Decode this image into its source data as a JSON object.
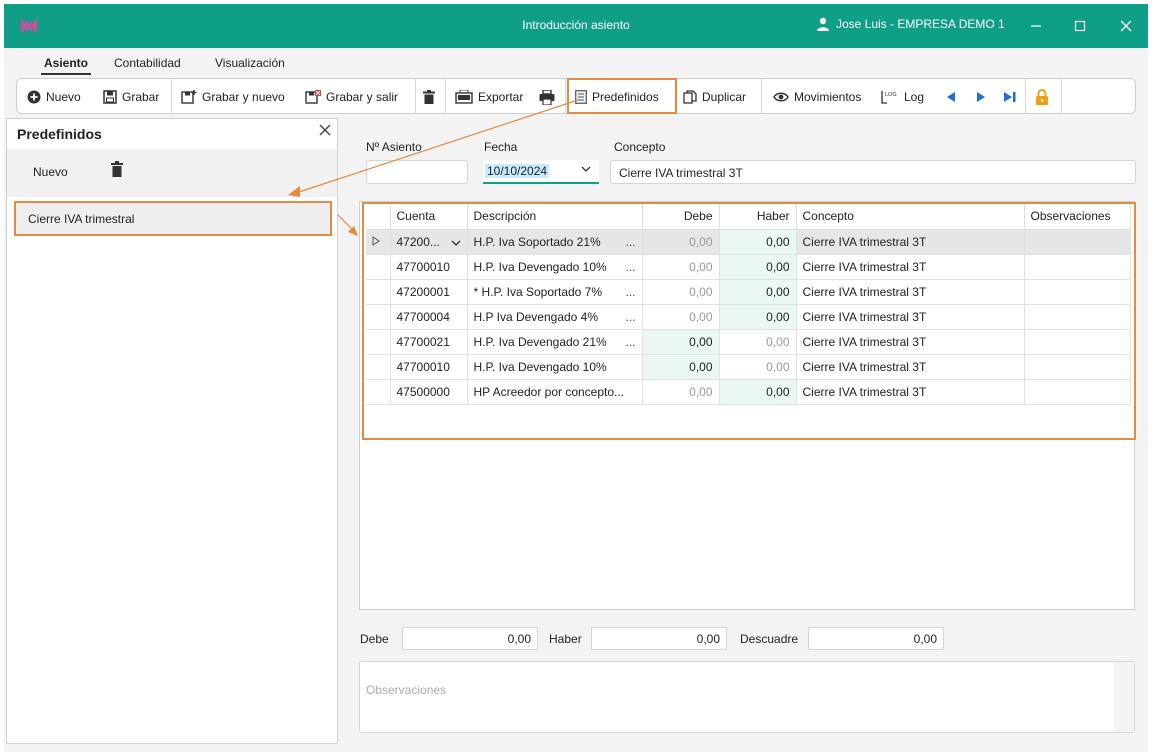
{
  "window": {
    "title": "Introducción asiento",
    "user": "Jose Luis - EMPRESA DEMO 1"
  },
  "menu_tabs": [
    "Asiento",
    "Contabilidad",
    "Visualización"
  ],
  "toolbar": {
    "nuevo": "Nuevo",
    "grabar": "Grabar",
    "grabar_nuevo": "Grabar y nuevo",
    "grabar_salir": "Grabar y salir",
    "exportar": "Exportar",
    "predefinidos": "Predefinidos",
    "duplicar": "Duplicar",
    "movimientos": "Movimientos",
    "log": "Log",
    "log_icon_text": "LOG"
  },
  "panel": {
    "title": "Predefinidos",
    "new_label": "Nuevo",
    "items": [
      "Cierre IVA trimestral"
    ]
  },
  "header": {
    "asiento_label": "Nº Asiento",
    "asiento_value": "",
    "fecha_label": "Fecha",
    "fecha_value": "10/10/2024",
    "concepto_label": "Concepto",
    "concepto_value": "Cierre IVA trimestral 3T"
  },
  "grid": {
    "columns": [
      "Cuenta",
      "Descripción",
      "Debe",
      "Haber",
      "Concepto",
      "Observaciones"
    ],
    "rows": [
      {
        "cuenta": "47200...",
        "descripcion": "H.P. Iva Soportado 21%",
        "debe": "0,00",
        "haber": "0,00",
        "concepto": "Cierre IVA trimestral 3T",
        "observaciones": ""
      },
      {
        "cuenta": "47700010",
        "descripcion": "H.P. Iva Devengado 10%",
        "debe": "0,00",
        "haber": "0,00",
        "concepto": "Cierre IVA trimestral 3T",
        "observaciones": ""
      },
      {
        "cuenta": "47200001",
        "descripcion": "* H.P. Iva Soportado 7%",
        "debe": "0,00",
        "haber": "0,00",
        "concepto": "Cierre IVA trimestral 3T",
        "observaciones": ""
      },
      {
        "cuenta": "47700004",
        "descripcion": "H.P Iva Devengado 4%",
        "debe": "0,00",
        "haber": "0,00",
        "concepto": "Cierre IVA trimestral 3T",
        "observaciones": ""
      },
      {
        "cuenta": "47700021",
        "descripcion": "H.P. Iva Devengado 21%",
        "debe": "0,00",
        "haber": "0,00",
        "concepto": "Cierre IVA trimestral 3T",
        "observaciones": ""
      },
      {
        "cuenta": "47700010",
        "descripcion": "H.P. Iva Devengado 10%",
        "debe": "0,00",
        "haber": "0,00",
        "concepto": "Cierre IVA trimestral 3T",
        "observaciones": ""
      },
      {
        "cuenta": "47500000",
        "descripcion": "HP Acreedor por concepto...",
        "debe": "0,00",
        "haber": "0,00",
        "concepto": "Cierre IVA trimestral 3T",
        "observaciones": ""
      }
    ],
    "ellipsis": "..."
  },
  "totals": {
    "debe_label": "Debe",
    "debe_value": "0,00",
    "haber_label": "Haber",
    "haber_value": "0,00",
    "descuadre_label": "Descuadre",
    "descuadre_value": "0,00"
  },
  "observaciones_placeholder": "Observaciones",
  "colors": {
    "titlebar": "#0e9f86",
    "highlight": "#e38b3f",
    "mint": "#eaf7f2"
  },
  "icons": [
    "app-logo-icon",
    "user-icon",
    "minimize-icon",
    "maximize-icon",
    "close-icon",
    "plus-circle-icon",
    "save-icon",
    "save-new-icon",
    "save-exit-icon",
    "trash-icon",
    "export-icon",
    "print-icon",
    "predefined-icon",
    "duplicate-icon",
    "eye-icon",
    "log-icon",
    "prev-icon",
    "next-icon",
    "last-icon",
    "lock-icon",
    "dropdown-chevron-icon",
    "row-indicator-icon"
  ]
}
